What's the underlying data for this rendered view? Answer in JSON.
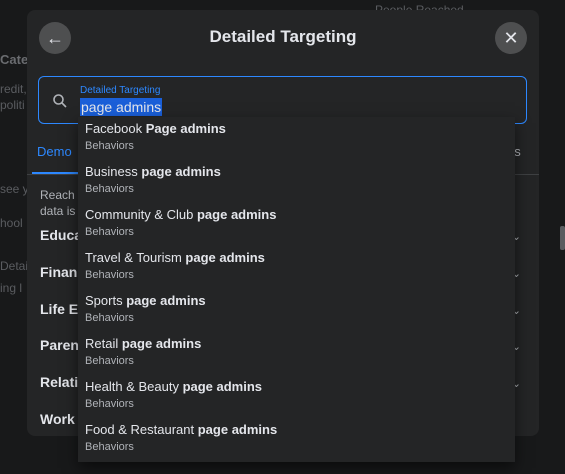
{
  "background": {
    "top_right": "People Reached",
    "left_texts": [
      "Cate",
      "redit,",
      "politi",
      "see y",
      "hool",
      "Detai",
      "ing l"
    ]
  },
  "modal": {
    "title": "Detailed Targeting",
    "search": {
      "label": "Detailed Targeting",
      "value": "page admins"
    },
    "tabs": {
      "active": "Demo",
      "right": "es"
    },
    "description": [
      "Reach p",
      "data is"
    ],
    "categories": [
      "Educa",
      "Finan",
      "Life Ev",
      "Paren",
      "Relati",
      "Work"
    ]
  },
  "dropdown": {
    "options": [
      {
        "prefix": "Facebook ",
        "bold": "Page admins",
        "category": "Behaviors"
      },
      {
        "prefix": "Business ",
        "bold": "page admins",
        "category": "Behaviors"
      },
      {
        "prefix": "Community & Club ",
        "bold": "page admins",
        "category": "Behaviors"
      },
      {
        "prefix": "Travel & Tourism ",
        "bold": "page admins",
        "category": "Behaviors"
      },
      {
        "prefix": "Sports ",
        "bold": "page admins",
        "category": "Behaviors"
      },
      {
        "prefix": "Retail ",
        "bold": "page admins",
        "category": "Behaviors"
      },
      {
        "prefix": "Health & Beauty ",
        "bold": "page admins",
        "category": "Behaviors"
      },
      {
        "prefix": "Food & Restaurant ",
        "bold": "page admins",
        "category": "Behaviors"
      }
    ]
  },
  "colors": {
    "accent": "#2d88ff",
    "modal_bg": "#242526",
    "page_bg": "#18191a"
  },
  "icons": {
    "back": "arrow-left-icon",
    "close": "close-icon",
    "search": "search-icon"
  }
}
